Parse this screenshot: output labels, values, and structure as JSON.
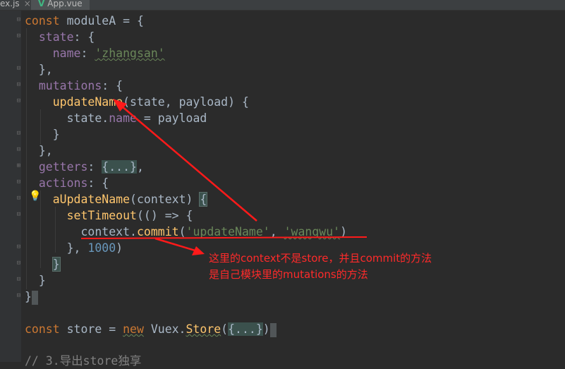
{
  "tabs": [
    {
      "label": "ex.js",
      "active": false
    },
    {
      "label": "App.vue",
      "active": true
    }
  ],
  "code_lines": {
    "l1": {
      "kw": "const",
      "name": " moduleA = {"
    },
    "l2": {
      "prop": "state",
      "rest": ": {"
    },
    "l3": {
      "prop": "name",
      "colon": ": ",
      "str": "'zhangsan'"
    },
    "l4": "},",
    "l5": {
      "prop": "mutations",
      "rest": ": {"
    },
    "l6": {
      "fn": "updateName",
      "rest": "(state, payload) {"
    },
    "l7": {
      "pre": "state.",
      "prop": "name",
      "rest": " = payload"
    },
    "l8": "}",
    "l9": "},",
    "l10": {
      "prop": "getters",
      "colon": ": ",
      "folded": "{...}",
      "rest": ","
    },
    "l11": {
      "prop": "actions",
      "rest": ": {"
    },
    "l12": {
      "fn": "aUpdateName",
      "rest": "(context) ",
      "brace": "{"
    },
    "l13": {
      "fn": "setTimeout",
      "rest": "(() => {"
    },
    "l14": {
      "pre": "context.",
      "fn": "commit",
      "open": "(",
      "str1": "'updateName'",
      "sep": ", ",
      "str2": "'wangwu'",
      "close": ")"
    },
    "l15": {
      "pre": "}, ",
      "num": "1000",
      "rest": ")"
    },
    "l16": "}",
    "l17": "}",
    "l18": "}",
    "l20": {
      "kw": "const",
      "name": " store = ",
      "kw2": "new",
      "pre": " Vuex.",
      "fn": "Store",
      "open": "(",
      "folded": "{...}",
      "close": ")"
    },
    "l22": "// 3.导出store独享"
  },
  "annotation": {
    "line1": "这里的context不是store，并且commit的方法",
    "line2": "是自己模块里的mutations的方法"
  },
  "colors": {
    "annotation_red": "#ff2a2a",
    "background": "#2b2b2b"
  }
}
